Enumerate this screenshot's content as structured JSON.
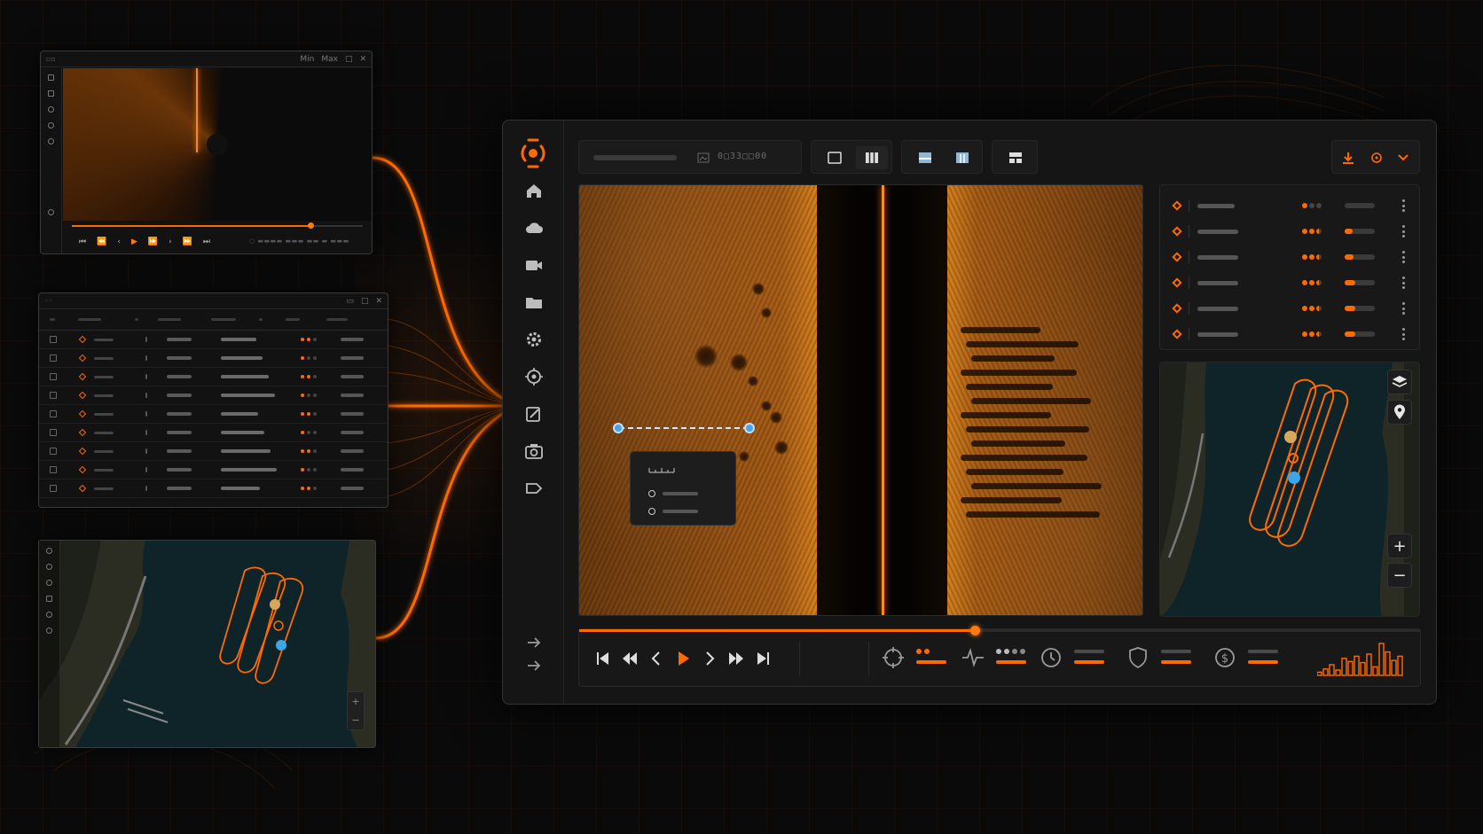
{
  "colors": {
    "accent": "#ff6a00",
    "accent_glow": "#ff8c1a",
    "bg": "#0a0a0a",
    "panel": "#151515",
    "measure": "#4da3e8",
    "track_marker_gold": "#d8a85a"
  },
  "sonar_window": {
    "title_icons": [
      "minimize-icon",
      "maximize-icon",
      "close-icon"
    ],
    "title_labels": [
      "Min",
      "Max"
    ],
    "sidebar_icons": [
      "square-icon",
      "square-icon",
      "search-icon",
      "target-icon",
      "settings-icon",
      "info-icon"
    ],
    "controls": [
      "skip-start-icon",
      "rewind-icon",
      "prev-icon",
      "play-icon",
      "next-icon",
      "fast-forward-icon",
      "skip-end-icon"
    ],
    "progress": 0.82
  },
  "table_window": {
    "row_count": 9
  },
  "main_toolbar": {
    "code_text": "0□33□□00",
    "views": [
      "single-view-icon",
      "split-view-icon",
      "image-view-icon",
      "columns-view-icon",
      "grid-view-icon"
    ],
    "actions": [
      "download-icon",
      "target-icon",
      "chevron-down-icon"
    ]
  },
  "rail_icons": [
    "home-icon",
    "cloud-icon",
    "video-icon",
    "folder-icon",
    "settings-icon",
    "target-icon",
    "edit-icon",
    "camera-icon",
    "tag-icon"
  ],
  "rail_bottom_icons": [
    "arrow-right-icon",
    "arrow-right-icon"
  ],
  "targets_list": [
    {
      "dots": [
        1,
        0,
        0
      ],
      "progress": 0.0
    },
    {
      "dots": [
        1,
        1,
        0.5
      ],
      "progress": 0.25
    },
    {
      "dots": [
        1,
        1,
        0.5
      ],
      "progress": 0.3
    },
    {
      "dots": [
        1,
        1,
        0.5
      ],
      "progress": 0.35
    },
    {
      "dots": [
        1,
        1,
        0.5
      ],
      "progress": 0.35
    },
    {
      "dots": [
        1,
        1,
        0.5
      ],
      "progress": 0.35
    }
  ],
  "map_controls": {
    "zoom_in": "+",
    "zoom_out": "−"
  },
  "mini_map_controls": {
    "zoom_in": "+",
    "zoom_out": "−"
  },
  "playback": {
    "progress": 0.47
  },
  "bottom_stats": [
    "crosshair-icon",
    "pulse-icon",
    "clock-icon",
    "shield-icon",
    "dollar-icon"
  ],
  "histogram": [
    3,
    6,
    10,
    5,
    16,
    13,
    18,
    12,
    20,
    8,
    30,
    22,
    14,
    18
  ]
}
